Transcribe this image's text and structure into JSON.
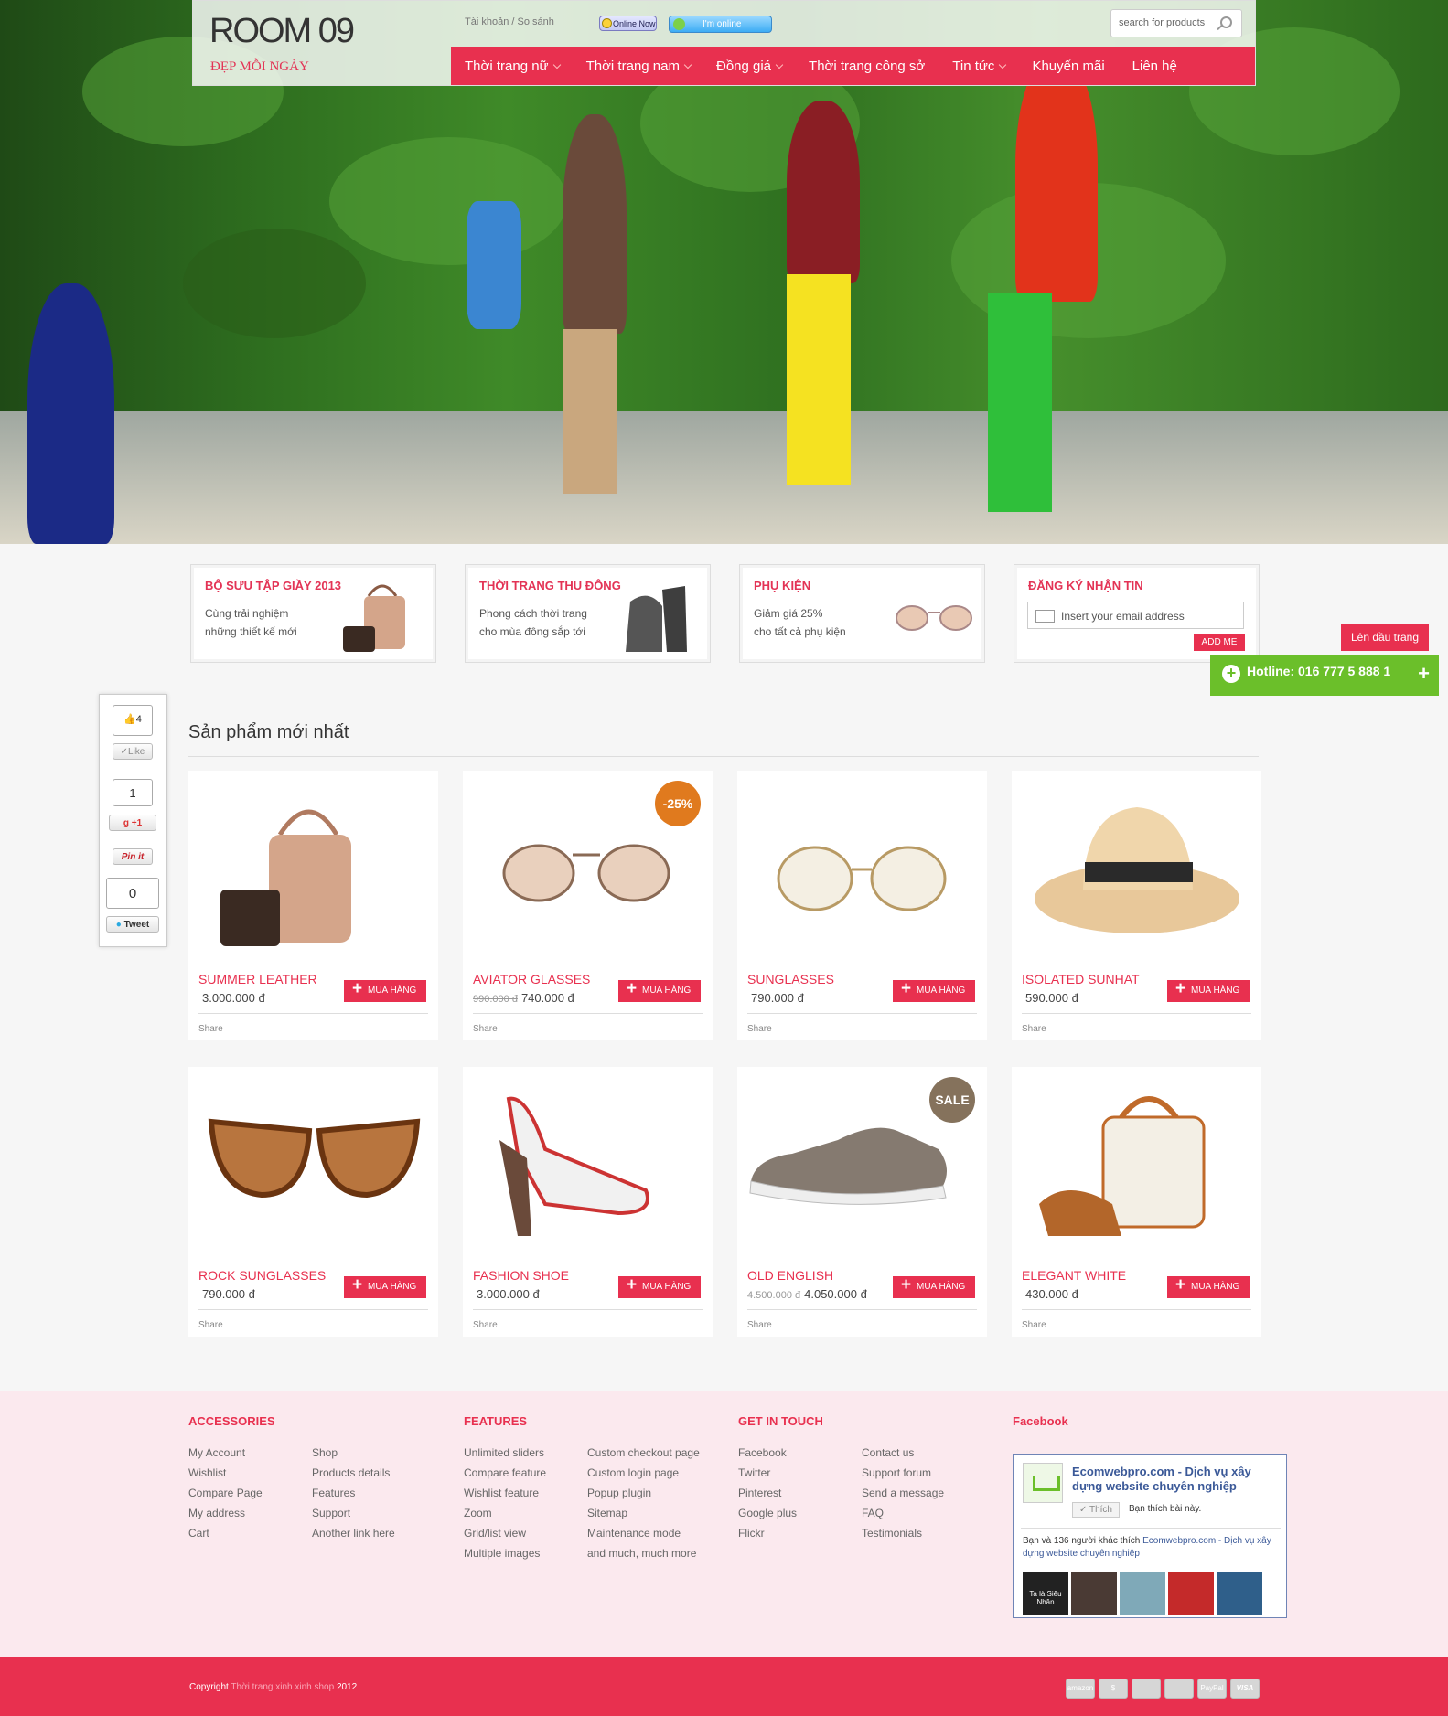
{
  "header": {
    "logo": "ROOM 09",
    "tagline": "ĐẸP MỖI NGÀY",
    "top_links": "Tài khoản / So sánh",
    "yahoo_status": "Online Now",
    "skype_status": "I'm online",
    "search_placeholder": "search for products"
  },
  "nav": [
    {
      "label": "Thời trang nữ",
      "dropdown": true
    },
    {
      "label": "Thời trang nam",
      "dropdown": true
    },
    {
      "label": "Đồng giá",
      "dropdown": true
    },
    {
      "label": "Thời trang công sở",
      "dropdown": false
    },
    {
      "label": "Tin tức",
      "dropdown": true
    },
    {
      "label": "Khuyến mãi",
      "dropdown": false
    },
    {
      "label": "Liên hệ",
      "dropdown": false
    }
  ],
  "promos": [
    {
      "title": "BỘ SƯU TẬP GIẦY 2013",
      "line1": "Cùng trải nghiệm",
      "line2": "những thiết kế mới"
    },
    {
      "title": "THỜI TRANG THU ĐÔNG",
      "line1": "Phong cách thời trang",
      "line2": "cho mùa đông sắp tới"
    },
    {
      "title": "PHỤ KIỆN",
      "line1": "Giảm giá 25%",
      "line2": "cho tất cả phụ kiện"
    },
    {
      "title": "ĐĂNG KÝ NHẬN TIN",
      "email_placeholder": "Insert your email address",
      "button": "ADD ME"
    }
  ],
  "floating": {
    "to_top": "Lên đầu trang",
    "hotline": "Hotline: 016 777 5 888 1"
  },
  "social": {
    "fb_count": "4",
    "like": "Like",
    "gplus_count": "1",
    "gplus": "+1",
    "pinit": "Pin it",
    "tweet_count": "0",
    "tweet": "Tweet"
  },
  "products": {
    "title": "Sản phẩm mới nhất",
    "buy_label": "MUA HÀNG",
    "share_label": "Share",
    "items": [
      {
        "name": "SUMMER LEATHER",
        "price": "3.000.000 đ",
        "old_price": ""
      },
      {
        "name": "AVIATOR GLASSES",
        "price": "740.000 đ",
        "old_price": "990.000 đ",
        "badge": "-25%"
      },
      {
        "name": "SUNGLASSES",
        "price": "790.000 đ",
        "old_price": ""
      },
      {
        "name": "ISOLATED SUNHAT",
        "price": "590.000 đ",
        "old_price": ""
      },
      {
        "name": "ROCK SUNGLASSES",
        "price": "790.000 đ",
        "old_price": ""
      },
      {
        "name": "FASHION SHOE",
        "price": "3.000.000 đ",
        "old_price": ""
      },
      {
        "name": "OLD ENGLISH",
        "price": "4.050.000 đ",
        "old_price": "4.500.000 đ",
        "badge": "SALE"
      },
      {
        "name": "ELEGANT WHITE",
        "price": "430.000 đ",
        "old_price": ""
      }
    ]
  },
  "footer": {
    "accessories": {
      "title": "ACCESSORIES",
      "col1": [
        "My Account",
        "Wishlist",
        "Compare Page",
        "My address",
        "Cart"
      ],
      "col2": [
        "Shop",
        "Products details",
        "Features",
        "Support",
        "Another link here"
      ]
    },
    "features": {
      "title": "FEATURES",
      "col1": [
        "Unlimited sliders",
        "Compare feature",
        "Wishlist feature",
        "Zoom",
        "Grid/list view",
        "Multiple images"
      ],
      "col2": [
        "Custom checkout page",
        "Custom login page",
        "Popup plugin",
        "Sitemap",
        "Maintenance mode",
        "and much, much more"
      ]
    },
    "touch": {
      "title": "GET IN TOUCH",
      "col1": [
        "Facebook",
        "Twitter",
        "Pinterest",
        "Google plus",
        "Flickr"
      ],
      "col2": [
        "Contact us",
        "Support forum",
        "Send a message",
        "FAQ",
        "Testimonials"
      ]
    },
    "facebook": {
      "title": "Facebook",
      "page_name": "Ecomwebpro.com - Dịch vụ xây dựng website chuyên nghiệp",
      "like_button": "Thích",
      "like_text": "Bạn thích bài này.",
      "friends_text": "Bạn và 136 người khác thích",
      "friends_page": "Ecomwebpro.com - Dịch vụ xây dựng website chuyên nghiệp",
      "avatar_caption": "Ta là Siêu Nhân"
    }
  },
  "bottom": {
    "copy_prefix": "Copyright",
    "copy_link": "Thời trang xinh xinh shop",
    "copy_year": "2012",
    "payments": [
      "amazon",
      "$",
      "",
      "",
      "PayPal",
      "VISA"
    ]
  },
  "colors": {
    "accent": "#e8304f",
    "hotline": "#6bbf2a",
    "footer_bg": "#fbe9ee"
  }
}
